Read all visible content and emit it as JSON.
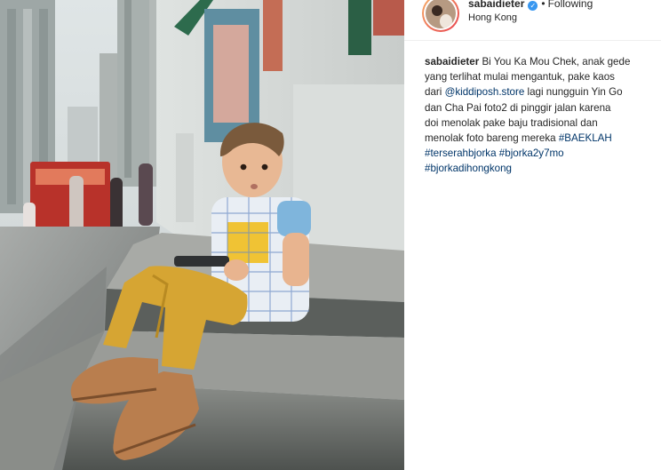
{
  "post": {
    "username": "sabaidieter",
    "verified_icon": "verified-badge-icon",
    "verified_glyph": "✓",
    "separator": "•",
    "follow_status": "Following",
    "location": "Hong Kong"
  },
  "caption": {
    "username": "sabaidieter",
    "line1": "Bi You Ka Mou Chek, anak gede",
    "line2": "yang terlihat mulai mengantuk, pake kaos",
    "line3_pre": "dari ",
    "mention": "@kiddiposh.store",
    "line3_post": " lagi nungguin Yin Go",
    "line4": "dan Cha Pai foto2 di pinggir jalan karena",
    "line5": "doi menolak pake baju tradisional dan",
    "line6_pre": "menolak foto bareng mereka ",
    "hashtag1": "#BAEKLAH",
    "hashtag2": "#terserahbjorka",
    "hashtag3": "#bjorka2y7mo",
    "hashtag4": "#bjorkadihongkong"
  },
  "colors": {
    "link": "#003569",
    "verified": "#3897f0",
    "text": "#262626"
  }
}
